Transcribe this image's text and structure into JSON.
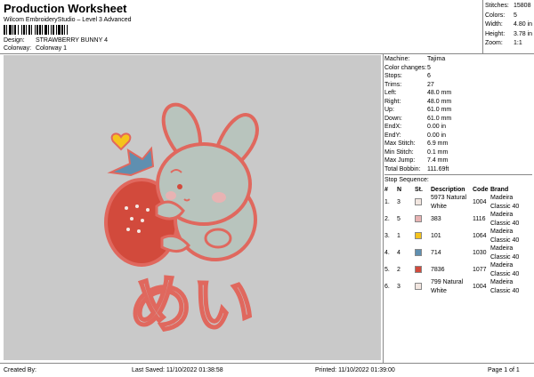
{
  "header": {
    "title": "Production Worksheet",
    "software": "Wilcom EmbroideryStudio – Level 3 Advanced",
    "design_label": "Design:",
    "design_value": "STRAWBERRY BUNNY 4",
    "colorway_label": "Colorway:",
    "colorway_value": "Colorway 1"
  },
  "top_stats": [
    {
      "k": "Stitches:",
      "v": "15808"
    },
    {
      "k": "Colors:",
      "v": "5"
    },
    {
      "k": "Width:",
      "v": "4.80 in"
    },
    {
      "k": "Height:",
      "v": "3.78 in"
    },
    {
      "k": "Zoom:",
      "v": "1:1"
    }
  ],
  "machine_info": [
    {
      "k": "Machine:",
      "v": "Tajima"
    },
    {
      "k": "Color changes:",
      "v": "5"
    },
    {
      "k": "Stops:",
      "v": "6"
    },
    {
      "k": "Trims:",
      "v": "27"
    },
    {
      "k": "Left:",
      "v": "48.0 mm"
    },
    {
      "k": "Right:",
      "v": "48.0 mm"
    },
    {
      "k": "Up:",
      "v": "61.0 mm"
    },
    {
      "k": "Down:",
      "v": "61.0 mm"
    },
    {
      "k": "EndX:",
      "v": "0.00 in"
    },
    {
      "k": "EndY:",
      "v": "0.00 in"
    },
    {
      "k": "Max Stitch:",
      "v": "6.9 mm"
    },
    {
      "k": "Min Stitch:",
      "v": "0.1 mm"
    },
    {
      "k": "Max Jump:",
      "v": "7.4 mm"
    },
    {
      "k": "Total Bobbin:",
      "v": "111.69ft"
    }
  ],
  "stop_sequence": {
    "label": "Stop Sequence:",
    "columns": [
      "#",
      "N",
      "St.",
      "Description",
      "Code",
      "Brand"
    ],
    "rows": [
      {
        "num": "1.",
        "n": "3",
        "color": "#f2e6e0",
        "st": "5973",
        "desc": "Natural White",
        "code": "1004",
        "brand": "Madeira Classic 40"
      },
      {
        "num": "2.",
        "n": "5",
        "color": "#e8b3b3",
        "st": "383",
        "desc": "",
        "code": "1116",
        "brand": "Madeira Classic 40"
      },
      {
        "num": "3.",
        "n": "1",
        "color": "#f5c31c",
        "st": "101",
        "desc": "",
        "code": "1064",
        "brand": "Madeira Classic 40"
      },
      {
        "num": "4.",
        "n": "4",
        "color": "#5f8fb0",
        "st": "714",
        "desc": "",
        "code": "1030",
        "brand": "Madeira Classic 40"
      },
      {
        "num": "5.",
        "n": "2",
        "color": "#d24a3c",
        "st": "7836",
        "desc": "",
        "code": "1077",
        "brand": "Madeira Classic 40"
      },
      {
        "num": "6.",
        "n": "3",
        "color": "#f2e6e0",
        "st": "799",
        "desc": "Natural White",
        "code": "1004",
        "brand": "Madeira Classic 40"
      }
    ]
  },
  "footer": {
    "created_by": "Created By:",
    "last_saved": "Last Saved: 11/10/2022 01:38:58",
    "printed": "Printed: 11/10/2022 01:39:00",
    "page": "Page 1 of 1"
  },
  "design_text": "めい",
  "colors": {
    "canvas": "#c9c9c9",
    "outline": "#e0685e",
    "strawberry": "#d24a3c",
    "bunny": "#b8c4bd",
    "heart": "#f5c31c",
    "leaf": "#5f8fb0"
  }
}
